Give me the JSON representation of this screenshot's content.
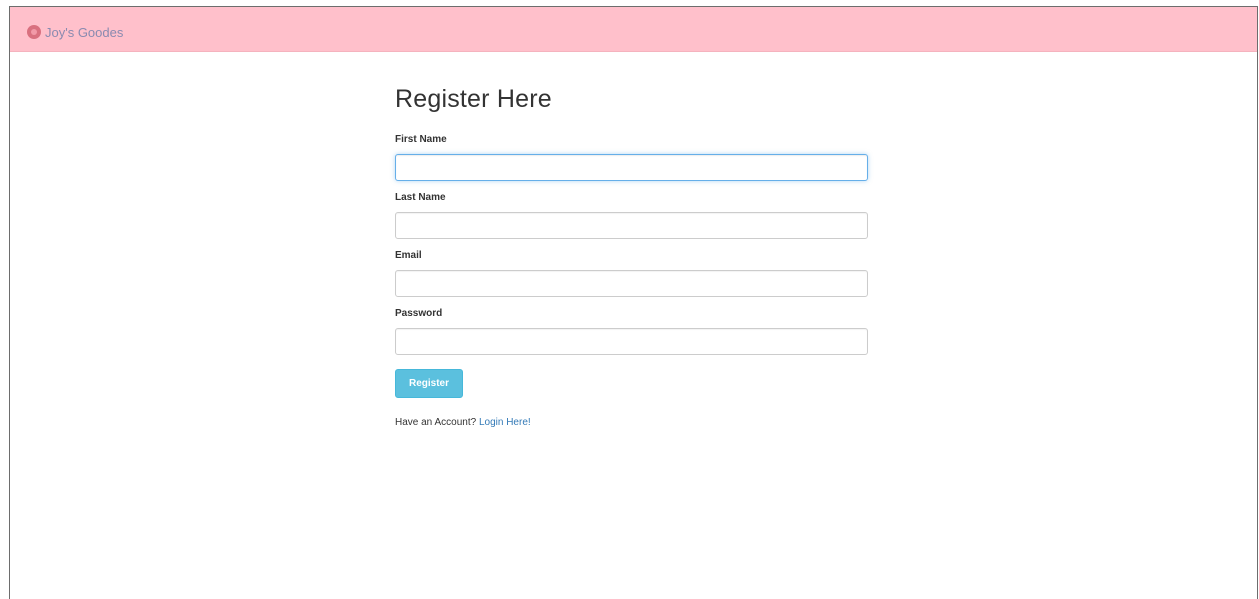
{
  "navbar": {
    "brand_icon": "cupcake-icon",
    "brand_text": "Joy's Goodes",
    "background_color": "#ffc0cb"
  },
  "form": {
    "title": "Register Here",
    "fields": [
      {
        "label": "First Name",
        "value": "",
        "placeholder": "",
        "focused": true
      },
      {
        "label": "Last Name",
        "value": "",
        "placeholder": ""
      },
      {
        "label": "Email",
        "value": "",
        "placeholder": ""
      },
      {
        "label": "Password",
        "value": "",
        "placeholder": ""
      }
    ],
    "submit_label": "Register",
    "submit_color": "#5bc0de",
    "account_prompt": "Have an Account?",
    "login_link": "Login Here!",
    "link_color": "#337ab7"
  }
}
